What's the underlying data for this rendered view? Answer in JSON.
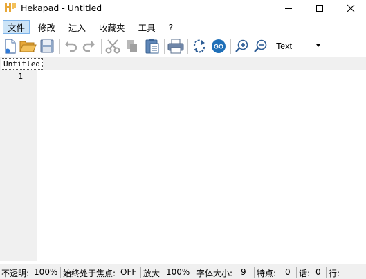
{
  "window": {
    "title": "Hekapad - Untitled",
    "controls": {
      "minimize": "minimize-icon",
      "maximize": "maximize-icon",
      "close": "close-icon"
    }
  },
  "menu": {
    "items": [
      {
        "label": "文件",
        "active": true
      },
      {
        "label": "修改"
      },
      {
        "label": "进入"
      },
      {
        "label": "收藏夹"
      },
      {
        "label": "工具"
      },
      {
        "label": "?"
      }
    ]
  },
  "toolbar": {
    "icons": [
      "new-file-icon",
      "open-folder-icon",
      "save-icon",
      "undo-icon",
      "redo-icon",
      "cut-icon",
      "copy-icon",
      "paste-icon",
      "print-icon",
      "refresh-icon",
      "go-icon",
      "zoom-in-icon",
      "zoom-out-icon"
    ],
    "go_label": "GO",
    "syntax_select": {
      "value": "Text"
    }
  },
  "tabs": [
    {
      "label": "Untitled"
    }
  ],
  "editor": {
    "line_numbers": [
      "1"
    ],
    "content": ""
  },
  "status": {
    "opacity_label": "不透明:",
    "opacity_value": "100%",
    "always_on_top_label": "始终处于焦点:",
    "always_on_top_value": "OFF",
    "zoom_label": "放大",
    "zoom_value": "100%",
    "font_size_label": "字体大小:",
    "font_size_value": "9",
    "chars_label": "特点:",
    "chars_value": "0",
    "words_label": "话:",
    "words_value": "0",
    "lines_label": "行:",
    "lines_value": ""
  },
  "colors": {
    "menu_active_bg": "#cce4f7",
    "gutter_bg": "#f0f0f0",
    "accent_blue": "#1e6fb8",
    "folder_orange": "#e8a838"
  }
}
